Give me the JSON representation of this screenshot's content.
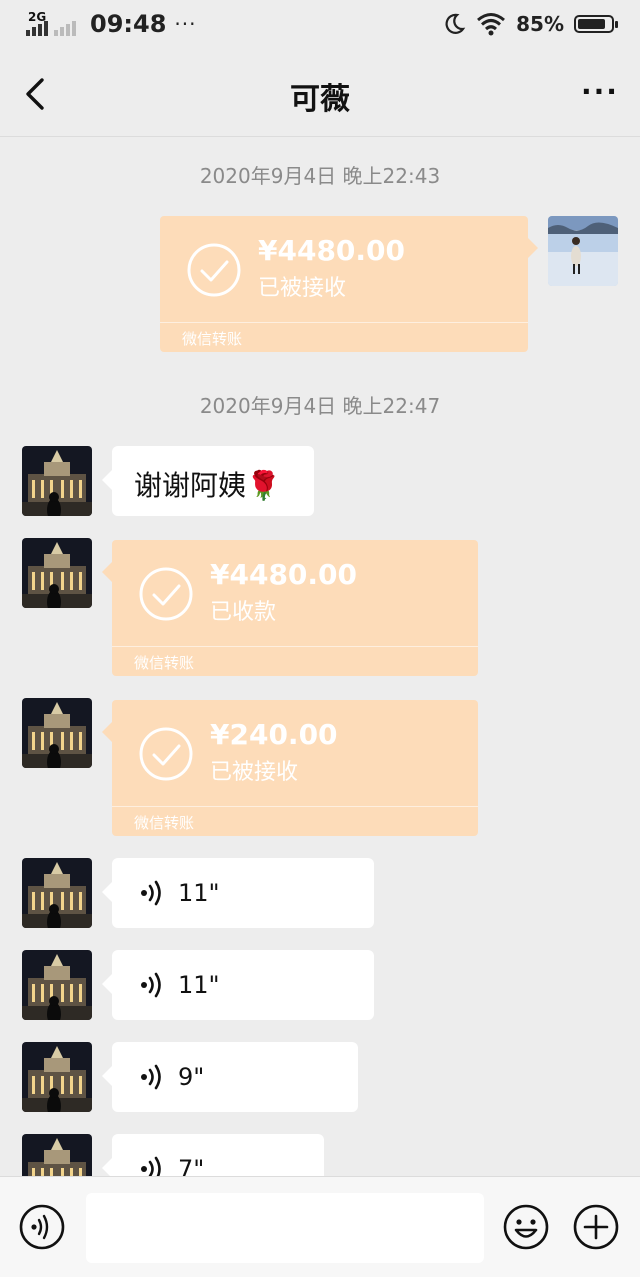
{
  "status_bar": {
    "network": "2G",
    "time": "09:48",
    "dots": "···",
    "battery_percent": "85%",
    "battery_level": 0.85
  },
  "nav": {
    "title": "可薇"
  },
  "messages": {
    "timestamp_1": "2020年9月4日 晚上22:43",
    "sent_transfer": {
      "amount": "¥4480.00",
      "status": "已被接收",
      "footer": "微信转账"
    },
    "timestamp_2": "2020年9月4日 晚上22:47",
    "thanks_text": "谢谢阿姨🌹",
    "transfer_received": {
      "amount": "¥4480.00",
      "status": "已收款",
      "footer": "微信转账"
    },
    "transfer_accepted": {
      "amount": "¥240.00",
      "status": "已被接收",
      "footer": "微信转账"
    },
    "voice_1": "11\"",
    "voice_2": "11\"",
    "voice_3": "9\"",
    "voice_4": "7\""
  },
  "colors": {
    "background": "#ededed",
    "transfer_bubble": "#fddcb9",
    "text_bubble": "#ffffff",
    "timestamp_text": "#8a8a8a"
  },
  "icons": {
    "back": "chevron-left-icon",
    "more": "more-dots-icon",
    "voice": "voice-wave-icon",
    "emoji": "smiley-face-icon",
    "plus": "plus-circle-icon",
    "check": "check-circle-icon"
  }
}
